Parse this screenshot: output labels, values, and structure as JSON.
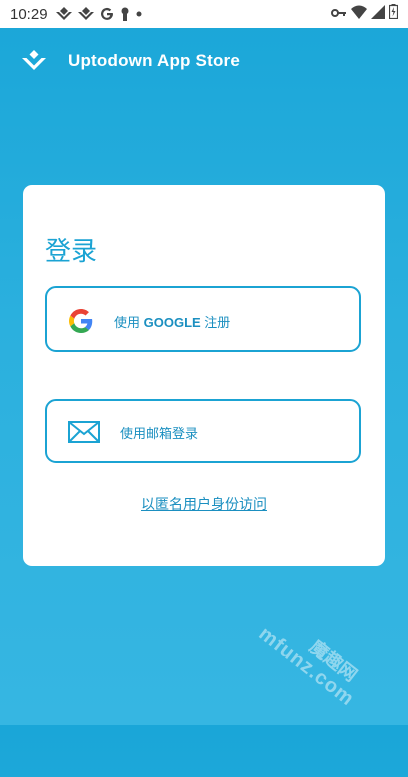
{
  "status_bar": {
    "time": "10:29",
    "icons_left": [
      "uptodown-logo-icon",
      "uptodown-logo-icon",
      "google-icon",
      "keyhole-icon",
      "dot-icon"
    ],
    "icons_right": [
      "key-icon",
      "wifi-icon",
      "signal-icon",
      "battery-icon"
    ]
  },
  "header": {
    "title": "Uptodown App Store",
    "logo_icon": "uptodown-logo-icon"
  },
  "card": {
    "title": "登录",
    "google_button": {
      "label_prefix": "使用 ",
      "label_brand": "GOOGLE",
      "label_suffix": " 注册",
      "icon": "google-icon"
    },
    "email_button": {
      "label": "使用邮箱登录",
      "icon": "mail-icon"
    },
    "anonymous_link": "以匿名用户身份访问"
  },
  "watermark": {
    "line1": "魔趣网",
    "line2": "mfunz.com"
  },
  "colors": {
    "accent": "#1ba3d3",
    "background_top": "#1aa6d8",
    "background_bottom": "#36b6e2",
    "card": "#ffffff"
  }
}
